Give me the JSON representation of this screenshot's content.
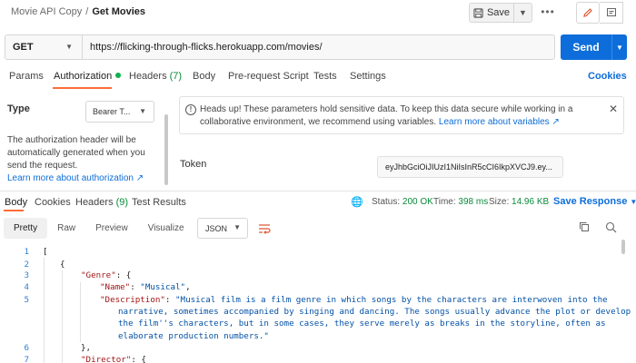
{
  "header": {
    "collection": "Movie API Copy",
    "separator": "/",
    "request_name": "Get Movies",
    "save_label": "Save",
    "more_label": "•••"
  },
  "request": {
    "method": "GET",
    "url": "https://flicking-through-flicks.herokuapp.com/movies/",
    "send_label": "Send"
  },
  "request_tabs": {
    "params": "Params",
    "authorization": "Authorization",
    "headers": "Headers",
    "headers_count": "(7)",
    "body": "Body",
    "prerequest": "Pre-request Script",
    "tests": "Tests",
    "settings": "Settings",
    "cookies": "Cookies"
  },
  "auth": {
    "type_label": "Type",
    "type_value": "Bearer T...",
    "help_text": "The authorization header will be automatically generated when you send the request.",
    "help_link": "Learn more about authorization ↗",
    "alert_text": "Heads up! These parameters hold sensitive data. To keep this data secure while working in a collaborative environment, we recommend using variables.",
    "alert_link": "Learn more about variables ↗",
    "token_label": "Token",
    "token_value": "eyJhbGciOiJIUzI1NiIsInR5cCI6IkpXVCJ9.ey..."
  },
  "response_tabs": {
    "body": "Body",
    "cookies": "Cookies",
    "headers": "Headers",
    "headers_count": "(9)",
    "test_results": "Test Results"
  },
  "response_status": {
    "status_label": "Status:",
    "status_value": "200 OK",
    "time_label": "Time:",
    "time_value": "398 ms",
    "size_label": "Size:",
    "size_value": "14.96 KB",
    "save_response": "Save Response"
  },
  "format": {
    "pretty": "Pretty",
    "raw": "Raw",
    "preview": "Preview",
    "visualize": "Visualize",
    "json": "JSON"
  },
  "code": {
    "line_numbers": [
      "1",
      "2",
      "3",
      "4",
      "5",
      "6",
      "7"
    ],
    "l1": "[",
    "l2": "{",
    "l3_key": "\"Genre\"",
    "l3_rest": ": {",
    "l4_key": "\"Name\"",
    "l4_sep": ": ",
    "l4_val": "\"Musical\"",
    "l4_end": ",",
    "l5_key": "\"Description\"",
    "l5_sep": ": ",
    "l5_val1": "\"Musical film is a film genre in which songs by the characters are interwoven into the",
    "l5_val2": "narrative, sometimes accompanied by singing and dancing. The songs usually advance the plot or develop",
    "l5_val3": "the film''s characters, but in some cases, they serve merely as breaks in the storyline, often as",
    "l5_val4": "elaborate production numbers.\"",
    "l6": "},",
    "l7_key": "\"Director\"",
    "l7_rest": ": {"
  },
  "colors": {
    "accent": "#ff6c37",
    "primary": "#0d6ddb",
    "success": "#0a8a3b"
  }
}
